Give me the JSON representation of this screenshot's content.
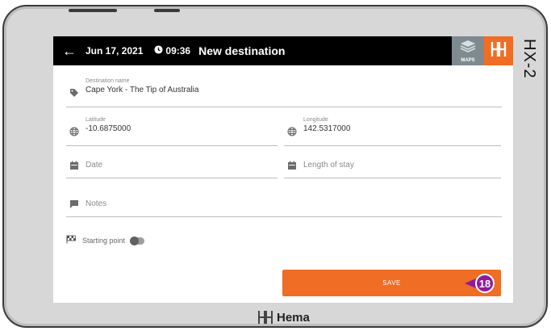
{
  "device": {
    "model": "HX-2",
    "brand": "Hema"
  },
  "topbar": {
    "date": "Jun 17, 2021",
    "time": "09:36",
    "title": "New destination",
    "maps_label": "MAPS"
  },
  "form": {
    "destination": {
      "label": "Destination name",
      "value": "Cape York - The Tip of Australia"
    },
    "latitude": {
      "label": "Latitude",
      "value": "-10.6875000"
    },
    "longitude": {
      "label": "Longitude",
      "value": "142.5317000"
    },
    "date": {
      "placeholder": "Date"
    },
    "length_of_stay": {
      "placeholder": "Length of stay"
    },
    "notes": {
      "placeholder": "Notes"
    },
    "starting_point": {
      "label": "Starting point",
      "enabled": false
    }
  },
  "save_label": "SAVE",
  "callout_number": "18",
  "colors": {
    "accent": "#ef6d24",
    "callout": "#8e1b9c",
    "topbar": "#000000",
    "maps": "#7d8b91"
  }
}
